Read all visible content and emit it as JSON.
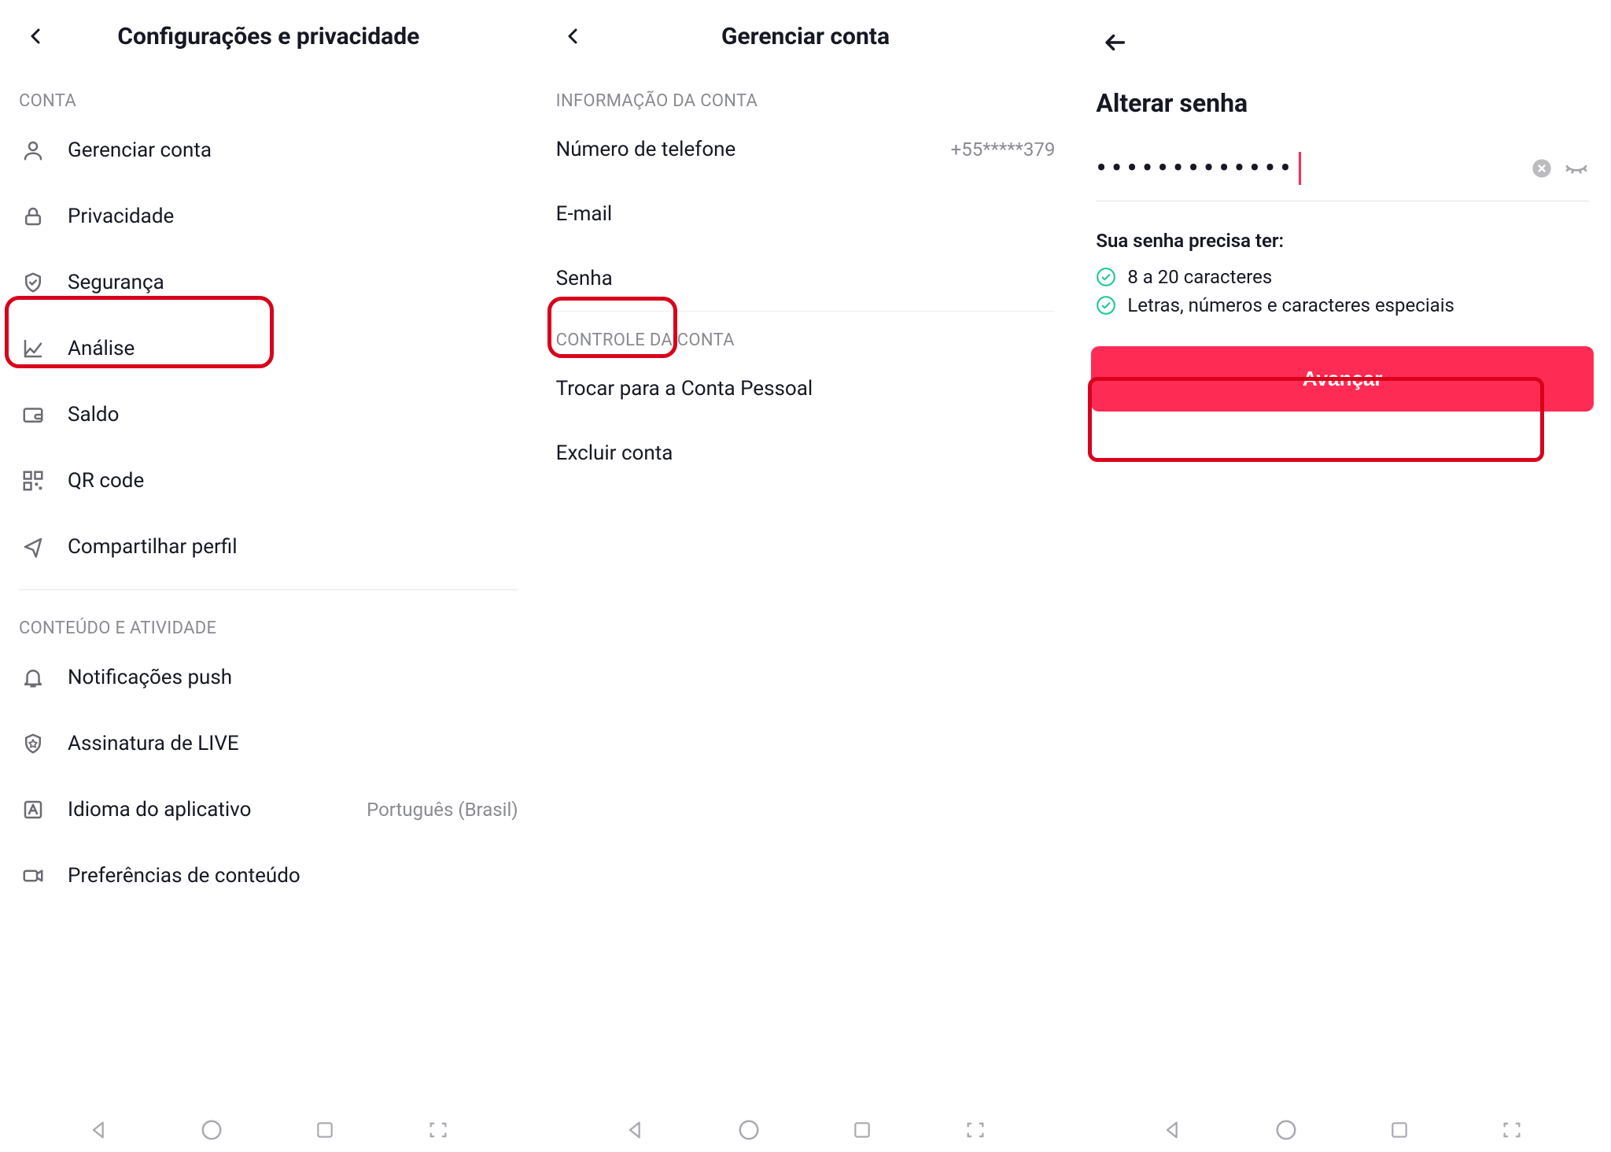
{
  "screen1": {
    "title": "Configurações e privacidade",
    "section_account": "CONTA",
    "items_account": [
      "Gerenciar conta",
      "Privacidade",
      "Segurança",
      "Análise",
      "Saldo",
      "QR code",
      "Compartilhar perfil"
    ],
    "section_content": "CONTEÚDO E ATIVIDADE",
    "items_content": [
      "Notificações push",
      "Assinatura de LIVE",
      "Idioma do aplicativo",
      "Preferências de conteúdo"
    ],
    "language_value": "Português (Brasil)"
  },
  "screen2": {
    "title": "Gerenciar conta",
    "section_info": "INFORMAÇÃO DA CONTA",
    "phone_label": "Número de telefone",
    "phone_value": "+55*****379",
    "email_label": "E-mail",
    "password_label": "Senha",
    "section_control": "CONTROLE DA CONTA",
    "switch_label": "Trocar para a Conta Pessoal",
    "delete_label": "Excluir conta"
  },
  "screen3": {
    "title": "Alterar senha",
    "password_mask": "•••••••••••••",
    "req_heading": "Sua senha precisa ter:",
    "req1": "8 a 20 caracteres",
    "req2": "Letras, números e caracteres especiais",
    "cta": "Avançar"
  }
}
